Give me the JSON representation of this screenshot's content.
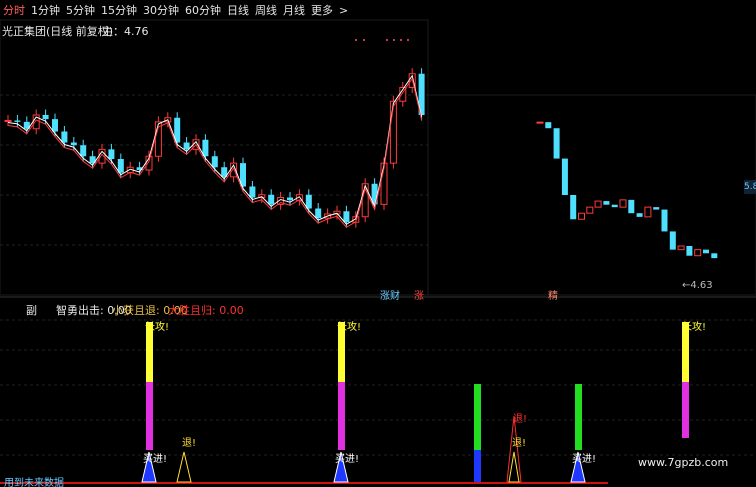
{
  "toolbar": {
    "items": [
      "分时",
      "1分钟",
      "5分钟",
      "15分钟",
      "30分钟",
      "60分钟",
      "日线",
      "周线",
      "月线",
      "更多"
    ],
    "more_icon": "chevron-right-icon"
  },
  "header": {
    "title": "光正集团(日线 前复权)",
    "main_label": "主：4.76"
  },
  "price_labels": {
    "low_marker": "←4.63",
    "right_edge": "5.8"
  },
  "chart_tags": {
    "tag1": "涨财",
    "tag2": "涨",
    "tag3": "精"
  },
  "sub_panel": {
    "label": "副",
    "indicators": [
      {
        "text": "智勇出击: 0.00",
        "color": "#e8e8e8"
      },
      {
        "text": "小获且退: 0.00",
        "color": "#e8c040"
      },
      {
        "text": "大胜且归: 0.00",
        "color": "#ff3030"
      }
    ],
    "signal_texts": {
      "attack": "长攻!",
      "retreat": "退!",
      "buy": "买进!"
    }
  },
  "watermark": "www.7gpzb.com",
  "bottom_note": "用到未来数据",
  "colors": {
    "up": "#ff3b3b",
    "down": "#4fe0ff",
    "ma": "#ffffff",
    "yellow": "#ffff33",
    "magenta": "#e030e0",
    "green": "#22dd22",
    "blue": "#1e38ff"
  },
  "chart_data": {
    "type": "candlestick",
    "series_close": [
      4.76,
      4.75,
      4.7,
      4.8,
      4.77,
      4.68,
      4.6,
      4.58,
      4.5,
      4.45,
      4.55,
      4.48,
      4.38,
      4.42,
      4.4,
      4.5,
      4.75,
      4.78,
      4.6,
      4.55,
      4.62,
      4.5,
      4.42,
      4.35,
      4.45,
      4.28,
      4.2,
      4.22,
      4.15,
      4.2,
      4.18,
      4.22,
      4.12,
      4.05,
      4.08,
      4.1,
      4.02,
      4.06,
      4.3,
      4.15,
      4.45,
      4.9,
      5.0,
      5.1,
      4.8
    ],
    "last_price": 4.76,
    "low": 4.63
  }
}
